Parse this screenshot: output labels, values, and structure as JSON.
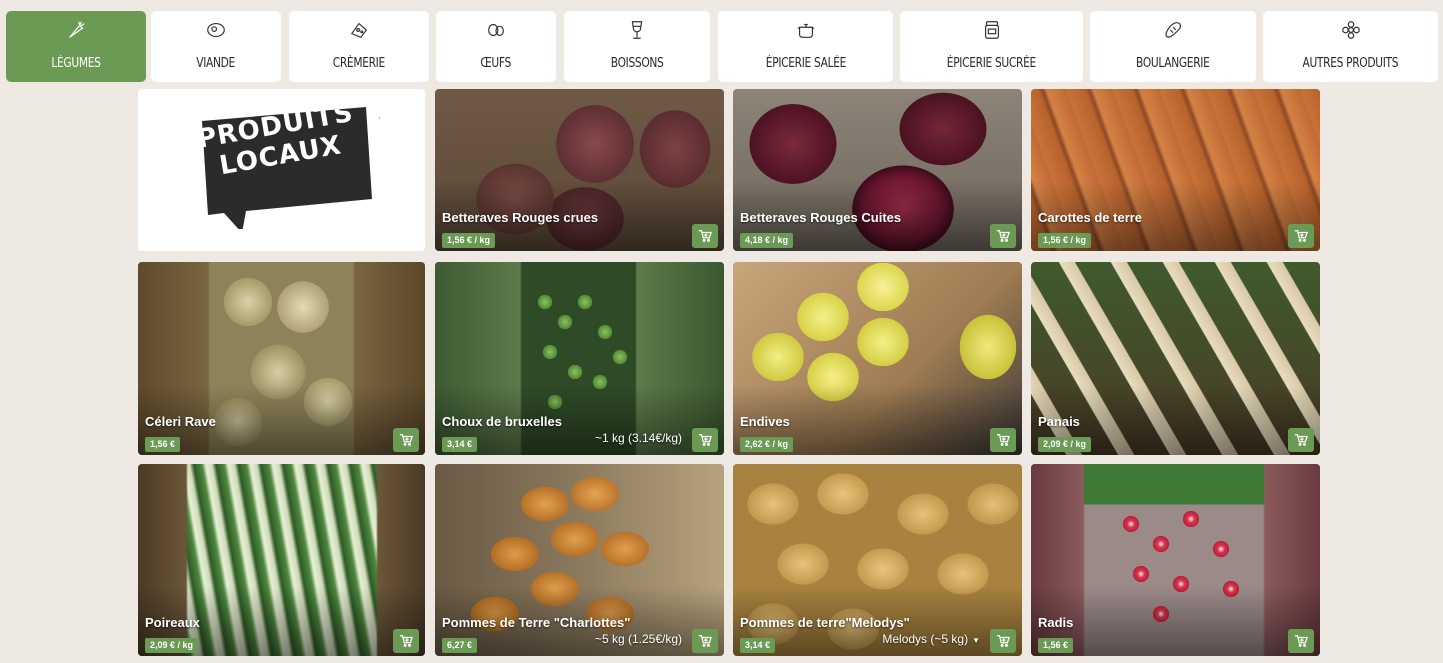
{
  "colors": {
    "accent": "#6b9a55",
    "background": "#efe9e4"
  },
  "nav": {
    "tabs": [
      {
        "label": "LÉGUMES",
        "icon": "carrot-icon",
        "active": true
      },
      {
        "label": "VIANDE",
        "icon": "steak-icon",
        "active": false
      },
      {
        "label": "CRÈMERIE",
        "icon": "cheese-icon",
        "active": false
      },
      {
        "label": "ŒUFS",
        "icon": "eggs-icon",
        "active": false
      },
      {
        "label": "BOISSONS",
        "icon": "wine-glass-icon",
        "active": false
      },
      {
        "label": "ÉPICERIE SALÉE",
        "icon": "cooking-pot-icon",
        "active": false
      },
      {
        "label": "ÉPICERIE SUCRÉE",
        "icon": "jam-jar-icon",
        "active": false
      },
      {
        "label": "BOULANGERIE",
        "icon": "bread-icon",
        "active": false
      },
      {
        "label": "AUTRES PRODUITS",
        "icon": "flower-icon",
        "active": false
      }
    ]
  },
  "promo": {
    "text_line1": "PRODUITS",
    "text_line2": "LOCAUX"
  },
  "products": [
    {
      "name": "Betteraves Rouges crues",
      "price": "1,56 € / kg"
    },
    {
      "name": "Betteraves Rouges Cuites",
      "price": "4,18 € / kg"
    },
    {
      "name": "Carottes de terre",
      "price": "1,56 € / kg"
    },
    {
      "name": "Céleri Rave",
      "price": "1,56 €"
    },
    {
      "name": "Choux de bruxelles",
      "price": "3,14 €",
      "unit": "~1 kg (3.14€/kg)"
    },
    {
      "name": "Endives",
      "price": "2,62 € / kg"
    },
    {
      "name": "Panais",
      "price": "2,09 € / kg"
    },
    {
      "name": "Poireaux",
      "price": "2,09 € / kg"
    },
    {
      "name": "Pommes de Terre \"Charlottes\"",
      "price": "6,27 €",
      "unit": "~5 kg (1.25€/kg)"
    },
    {
      "name": "Pommes de terre\"Melodys\"",
      "price": "3,14 €",
      "unit": "Melodys (~5 kg)"
    },
    {
      "name": "Radis",
      "price": "1,56 €"
    }
  ]
}
